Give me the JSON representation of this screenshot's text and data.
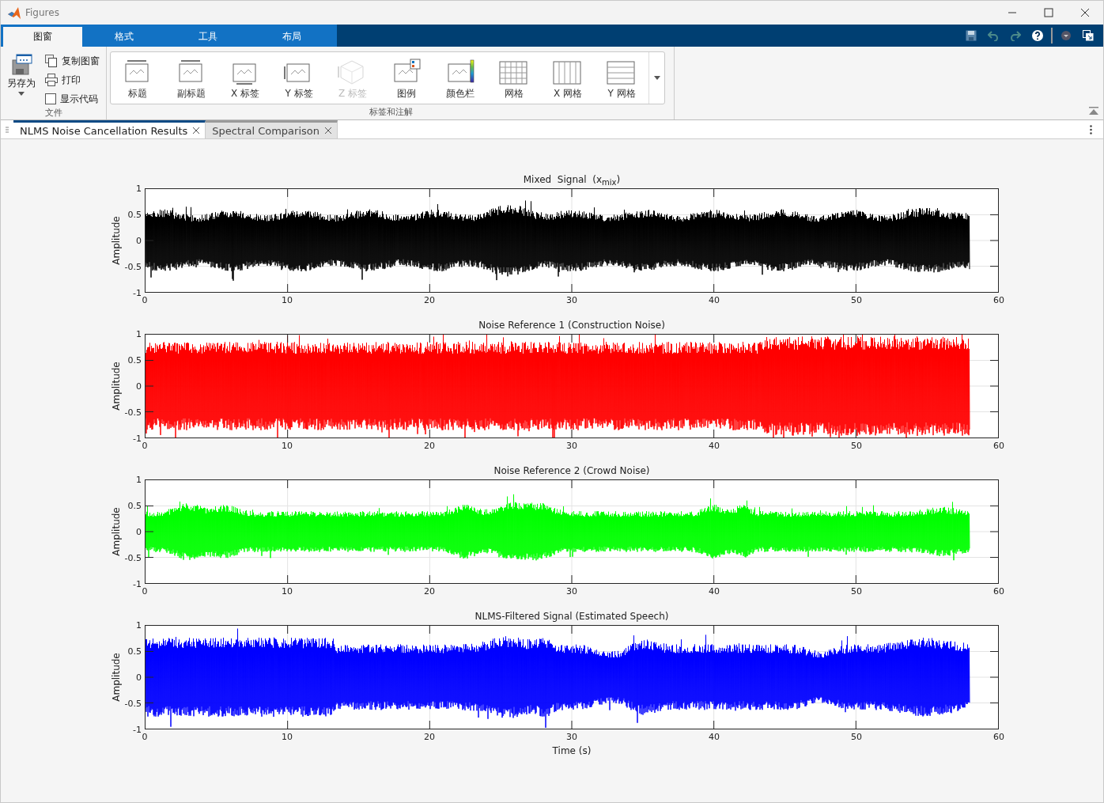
{
  "window": {
    "title": "Figures"
  },
  "ribbon_tabs": [
    {
      "label": "图窗",
      "selected": true
    },
    {
      "label": "格式",
      "selected": false
    },
    {
      "label": "工具",
      "selected": false
    },
    {
      "label": "布局",
      "selected": false
    }
  ],
  "file_section": {
    "label": "文件",
    "save_as": "另存为",
    "items": [
      {
        "kind": "button",
        "label": "复制图窗"
      },
      {
        "kind": "button",
        "label": "打印"
      },
      {
        "kind": "checkbox",
        "label": "显示代码",
        "checked": false
      }
    ]
  },
  "annotation_section": {
    "label": "标签和注解",
    "gallery": [
      {
        "kind": "title",
        "label": "标题",
        "disabled": false
      },
      {
        "kind": "subtitle",
        "label": "副标题",
        "disabled": false
      },
      {
        "kind": "xlabel",
        "label": "X 标签",
        "disabled": false
      },
      {
        "kind": "ylabel",
        "label": "Y 标签",
        "disabled": false
      },
      {
        "kind": "zlabel",
        "label": "Z 标签",
        "disabled": true
      },
      {
        "kind": "legend",
        "label": "图例",
        "disabled": false
      },
      {
        "kind": "colorbar",
        "label": "颜色栏",
        "disabled": false
      },
      {
        "kind": "grid",
        "label": "网格",
        "disabled": false
      },
      {
        "kind": "xgrid",
        "label": "X 网格",
        "disabled": false
      },
      {
        "kind": "ygrid",
        "label": "Y 网格",
        "disabled": false
      }
    ]
  },
  "document_tabs": [
    {
      "label": "NLMS Noise Cancellation Results",
      "selected": true
    },
    {
      "label": "Spectral Comparison",
      "selected": false
    }
  ],
  "plots": [
    {
      "title": "Mixed  Signal  (x$_{mix}$)",
      "ylabel": "Amplitude",
      "color": "#000000",
      "yticks": [
        "1",
        "0.5",
        "0",
        "-0.5",
        "-1"
      ],
      "xticks": [
        "0",
        "10",
        "20",
        "30",
        "40",
        "50",
        "60"
      ]
    },
    {
      "title": "Noise Reference 1 (Construction Noise)",
      "ylabel": "Amplitude",
      "color": "#ff0000",
      "yticks": [
        "1",
        "0.5",
        "0",
        "-0.5",
        "-1"
      ],
      "xticks": [
        "0",
        "10",
        "20",
        "30",
        "40",
        "50",
        "60"
      ]
    },
    {
      "title": "Noise Reference 2 (Crowd Noise)",
      "ylabel": "Amplitude",
      "color": "#00ff00",
      "yticks": [
        "1",
        "0.5",
        "0",
        "-0.5",
        "-1"
      ],
      "xticks": [
        "0",
        "10",
        "20",
        "30",
        "40",
        "50",
        "60"
      ]
    },
    {
      "title": "NLMS-Filtered Signal (Estimated Speech)",
      "ylabel": "Amplitude",
      "color": "#0000ff",
      "yticks": [
        "1",
        "0.5",
        "0",
        "-0.5",
        "-1"
      ],
      "xticks": [
        "0",
        "10",
        "20",
        "30",
        "40",
        "50",
        "60"
      ],
      "xlabel": "Time (s)"
    }
  ]
}
